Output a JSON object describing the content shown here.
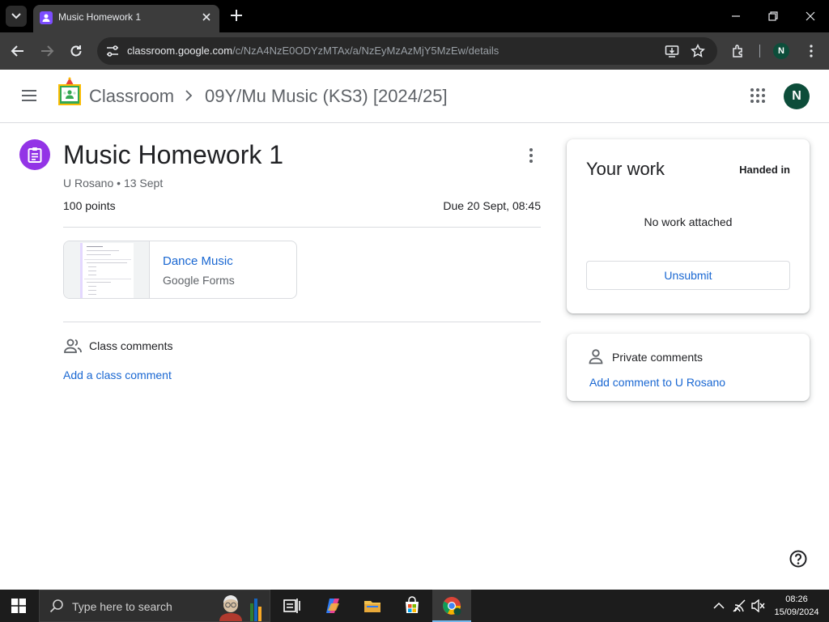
{
  "browser": {
    "tab_title": "Music Homework 1",
    "url_host": "classroom.google.com",
    "url_path": "/c/NzA4NzE0ODYzMTAx/a/NzEyMzAzMjY5MzEw/details",
    "profile_initial": "N"
  },
  "header": {
    "app_name": "Classroom",
    "class_name": "09Y/Mu Music (KS3) [2024/25]",
    "avatar_initial": "N"
  },
  "assignment": {
    "title": "Music Homework 1",
    "author": "U Rosano",
    "date": "13 Sept",
    "points": "100 points",
    "due": "Due 20 Sept, 08:45",
    "attachment": {
      "title": "Dance Music",
      "type": "Google Forms"
    }
  },
  "comments": {
    "title": "Class comments",
    "add_label": "Add a class comment"
  },
  "your_work": {
    "title": "Your work",
    "status": "Handed in",
    "empty_text": "No work attached",
    "button_label": "Unsubmit"
  },
  "private_comments": {
    "title": "Private comments",
    "add_label": "Add comment to U Rosano"
  },
  "taskbar": {
    "search_placeholder": "Type here to search",
    "time": "08:26",
    "date": "15/09/2024"
  },
  "colors": {
    "assignment_accent": "#9334e6",
    "link": "#1967d2",
    "avatar": "#0d4d3a"
  }
}
